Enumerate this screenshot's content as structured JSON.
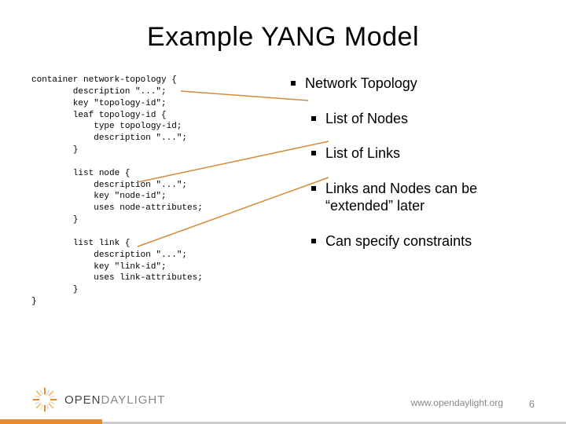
{
  "title": "Example YANG Model",
  "code": "container network-topology {\n        description \"...\";\n        key \"topology-id\";\n        leaf topology-id {\n            type topology-id;\n            description \"...\";\n        }\n\n        list node {\n            description \"...\";\n            key \"node-id\";\n            uses node-attributes;\n        }\n\n        list link {\n            description \"...\";\n            key \"link-id\";\n            uses link-attributes;\n        }\n}",
  "bullets": {
    "b1": "Network Topology",
    "b2": "List of Nodes",
    "b3": "List of Links",
    "b4": "Links and Nodes can be “extended” later",
    "b5": "Can specify constraints"
  },
  "brand": {
    "open": "OPEN",
    "daylight": "DAYLIGHT"
  },
  "footer_url": "www.opendaylight.org",
  "page_number": "6"
}
